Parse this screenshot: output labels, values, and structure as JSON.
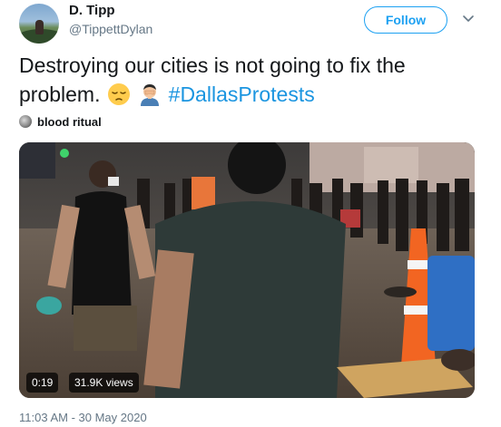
{
  "user": {
    "name": "D. Tipp",
    "handle": "@TippettDylan"
  },
  "follow_label": "Follow",
  "menu_icon": "chevron-down-icon",
  "tweet": {
    "line1": "Destroying our cities is not going to  fix the",
    "line2": "problem.",
    "emoji1": "pensive-face-emoji",
    "emoji2": "person-facepalming-emoji",
    "hashtag": "#DallasProtests"
  },
  "context": {
    "name": "blood ritual"
  },
  "media": {
    "duration": "0:19",
    "views": "31.9K views"
  },
  "timestamp": "11:03 AM - 30 May 2020",
  "colors": {
    "brand": "#1da1f2",
    "hashtag": "#1b95e0",
    "secondary_text": "#657786",
    "cone": "#f26522"
  }
}
